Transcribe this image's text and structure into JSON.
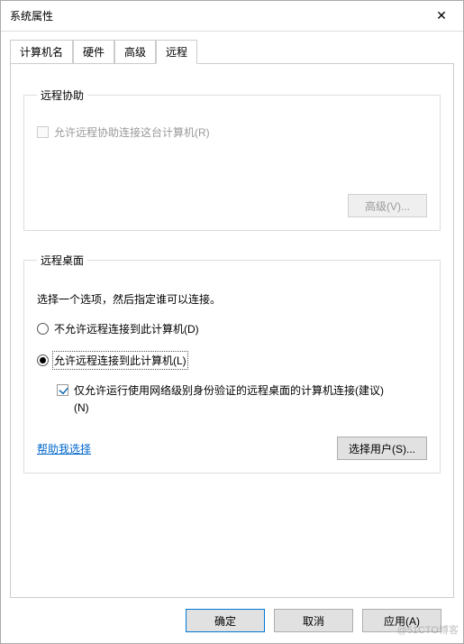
{
  "window": {
    "title": "系统属性"
  },
  "tabs": {
    "computer_name": "计算机名",
    "hardware": "硬件",
    "advanced": "高级",
    "remote": "远程"
  },
  "remote_assist": {
    "legend": "远程协助",
    "allow_label": "允许远程协助连接这台计算机(R)",
    "advanced_btn": "高级(V)..."
  },
  "remote_desktop": {
    "legend": "远程桌面",
    "instruction": "选择一个选项，然后指定谁可以连接。",
    "opt_disallow": "不允许远程连接到此计算机(D)",
    "opt_allow": "允许远程连接到此计算机(L)",
    "nla_label_line1": "仅允许运行使用网络级别身份验证的远程桌面的计算机连接(建议)",
    "nla_label_line2": "(N)",
    "help_link": "帮助我选择",
    "select_users_btn": "选择用户(S)..."
  },
  "footer": {
    "ok": "确定",
    "cancel": "取消",
    "apply": "应用(A)"
  },
  "watermark": "@51CTO博客"
}
